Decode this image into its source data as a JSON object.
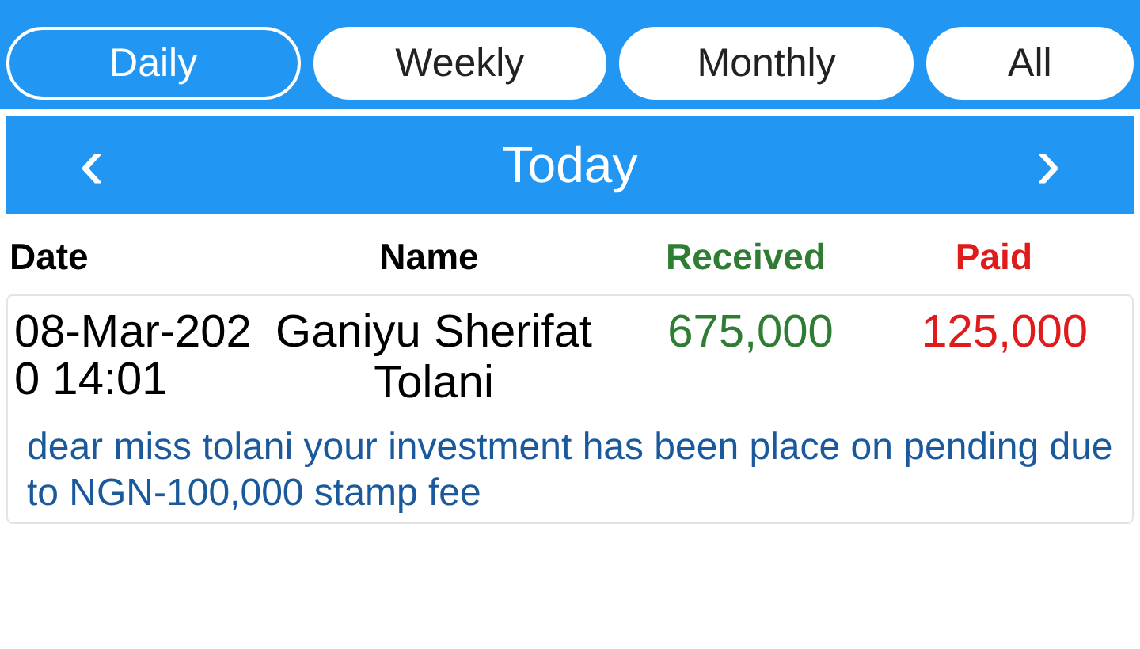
{
  "tabs": [
    {
      "label": "Daily",
      "selected": true
    },
    {
      "label": "Weekly",
      "selected": false
    },
    {
      "label": "Monthly",
      "selected": false
    },
    {
      "label": "All",
      "selected": false
    }
  ],
  "period_bar": {
    "prev": "‹",
    "title": "Today",
    "next": "›"
  },
  "table": {
    "columns": [
      "Date",
      "Name",
      "Received",
      "Paid"
    ],
    "rows": [
      {
        "date": "08-Mar-2020 14:01",
        "name": "Ganiyu Sherifat Tolani",
        "received": "675,000",
        "paid": "125,000",
        "note": "dear miss tolani your investment has been place on pending due to NGN-100,000 stamp fee"
      }
    ]
  }
}
